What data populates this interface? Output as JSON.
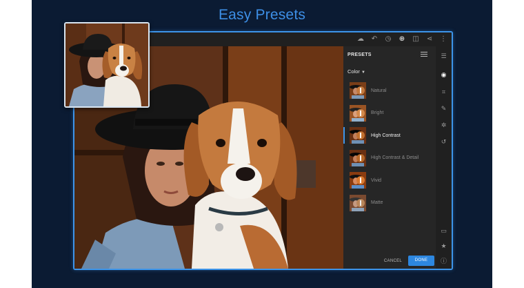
{
  "headline": "Easy Presets",
  "panel": {
    "title": "PRESETS",
    "group": "Color"
  },
  "presets": [
    {
      "label": "Natural",
      "selected": false
    },
    {
      "label": "Bright",
      "selected": false
    },
    {
      "label": "High Contrast",
      "selected": true
    },
    {
      "label": "High Contrast & Detail",
      "selected": false
    },
    {
      "label": "Vivid",
      "selected": false
    },
    {
      "label": "Matte",
      "selected": false
    }
  ],
  "actions": {
    "cancel": "CANCEL",
    "done": "DONE"
  },
  "colors": {
    "accent": "#3d95ea",
    "background": "#0b1b33",
    "panel": "#262626"
  },
  "icons": {
    "topbar": [
      "cloud-icon",
      "undo-icon",
      "history-icon",
      "add-icon",
      "compare-icon",
      "share-icon",
      "more-icon"
    ],
    "tools": [
      "edit-sliders-icon",
      "presets-icon",
      "crop-icon",
      "healing-brush-icon",
      "selective-icon",
      "versions-icon",
      "comment-icon",
      "star-icon",
      "info-icon"
    ]
  }
}
